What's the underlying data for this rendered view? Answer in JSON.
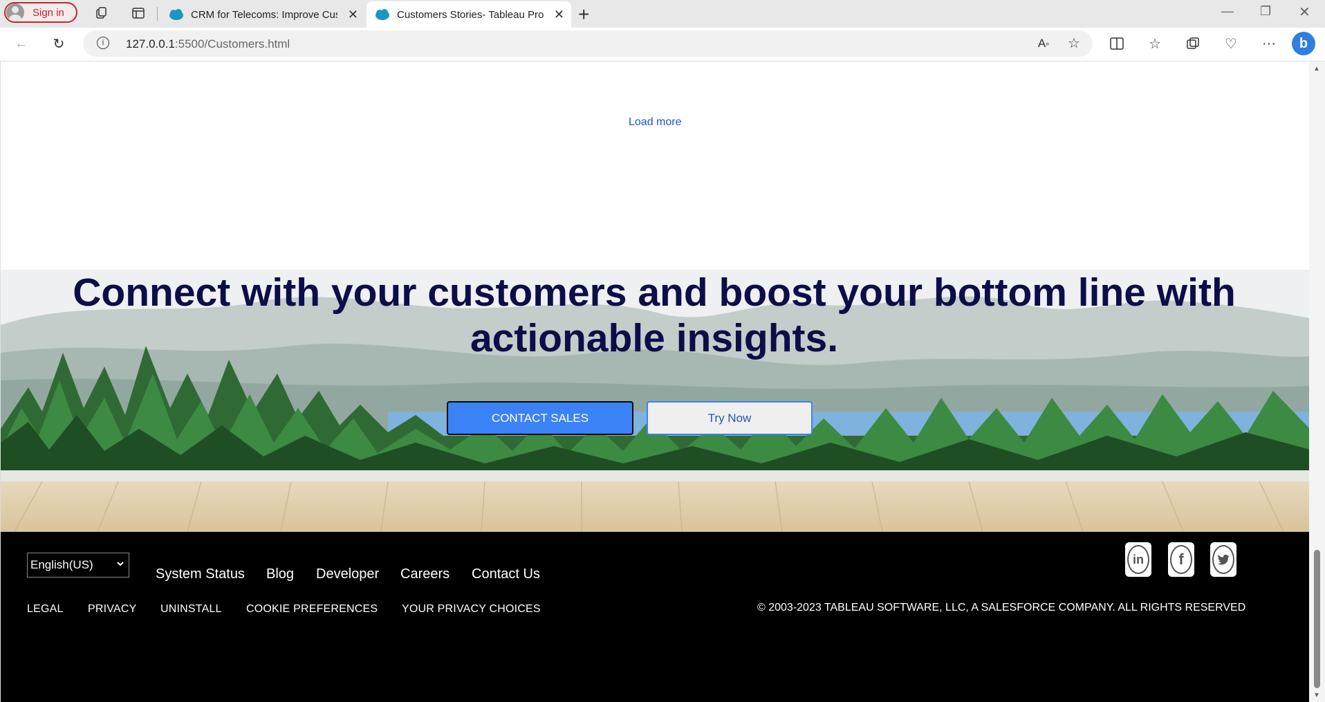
{
  "browser": {
    "signin_label": "Sign in",
    "tabs": [
      {
        "title": "CRM for Telecoms: Improve Customer",
        "active": false
      },
      {
        "title": "Customers Stories- Tableau Products",
        "active": true
      }
    ],
    "url_host": "127.0.0.1",
    "url_path": ":5500/Customers.html"
  },
  "page": {
    "load_more": "Load more",
    "hero": {
      "headline": "Connect with your customers and boost your bottom line with actionable insights.",
      "contact_label": "CONTACT SALES",
      "try_label": "Try Now"
    },
    "footer": {
      "language": "English(US)",
      "nav": [
        "System Status",
        "Blog",
        "Developer",
        "Careers",
        "Contact Us"
      ],
      "legal": [
        "LEGAL",
        "PRIVACY",
        "UNINSTALL",
        "COOKIE PREFERENCES",
        "YOUR PRIVACY CHOICES"
      ],
      "copyright": "© 2003-2023 TABLEAU SOFTWARE, LLC, A SALESFORCE COMPANY. ALL RIGHTS RESERVED",
      "social": [
        "linkedin-icon",
        "facebook-icon",
        "twitter-icon"
      ]
    }
  },
  "colors": {
    "headline": "#0b0e48",
    "primary_button": "#3b82f6",
    "link": "#1a56c8",
    "footer_bg": "#000000"
  }
}
